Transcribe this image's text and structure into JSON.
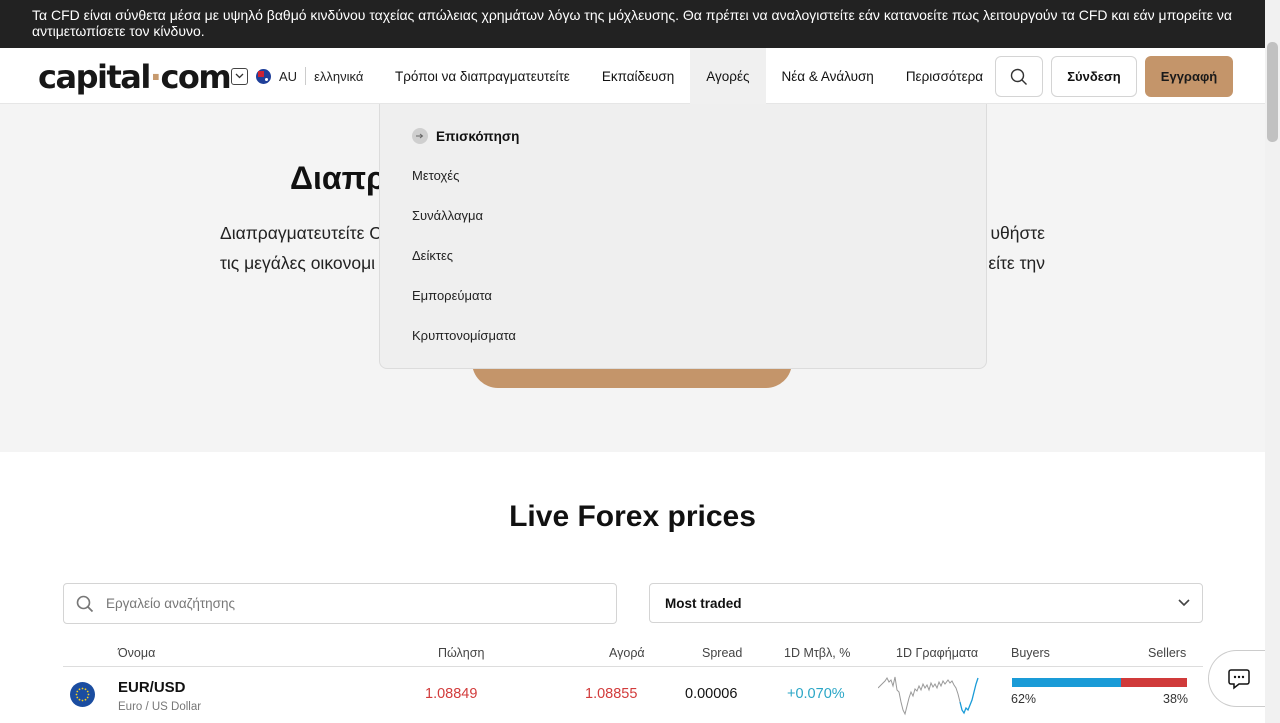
{
  "risk_warning": "Τα CFD είναι σύνθετα μέσα με υψηλό βαθμό κινδύνου ταχείας απώλειας χρημάτων λόγω της μόχλευσης. Θα πρέπει να αναλογιστείτε εάν κατανοείτε πως λειτουργούν τα CFD και εάν μπορείτε να αντιμετωπίσετε τον κίνδυνο.",
  "header": {
    "logo_main": "capital",
    "logo_dot": "·",
    "logo_tld": "com",
    "region_code": "AU",
    "language": "ελληνικά",
    "nav": [
      {
        "label": "Τρόποι να διαπραγματευτείτε"
      },
      {
        "label": "Εκπαίδευση"
      },
      {
        "label": "Αγορές"
      },
      {
        "label": "Νέα & Ανάλυση"
      },
      {
        "label": "Περισσότερα"
      }
    ],
    "login_label": "Σύνδεση",
    "signup_label": "Εγγραφή"
  },
  "hero": {
    "title": "Διαπρ",
    "text_line1": "Διαπραγματευτείτε C",
    "text_line1_end": "υθήστε",
    "text_line2": "τις μεγάλες οικονομι",
    "text_line2_end": "είτε την",
    "cta": ""
  },
  "markets_menu": {
    "overview": "Επισκόπηση",
    "items": [
      {
        "label": "Μετοχές"
      },
      {
        "label": "Συνάλλαγμα"
      },
      {
        "label": "Δείκτες"
      },
      {
        "label": "Εμπορεύματα"
      },
      {
        "label": "Κρυπτονομίσματα"
      }
    ]
  },
  "prices": {
    "title": "Live Forex prices",
    "search_placeholder": "Εργαλείο αναζήτησης",
    "sort_selected": "Most traded",
    "columns": {
      "name": "Όνομα",
      "sell": "Πώληση",
      "buy": "Αγορά",
      "spread": "Spread",
      "change": "1D Μτβλ, %",
      "chart": "1D Γραφήματα",
      "buyers": "Buyers",
      "sellers": "Sellers"
    },
    "rows": [
      {
        "symbol": "EUR/USD",
        "description": "Euro / US Dollar",
        "sell": "1.08849",
        "buy": "1.08855",
        "spread": "0.00006",
        "change": "+0.070%",
        "buyers_pct_label": "62%",
        "sellers_pct_label": "38%",
        "buyers_fraction": 0.62
      }
    ]
  },
  "colors": {
    "accent": "#c4956a",
    "risk_bar": "#222222",
    "sell": "#d23b3b",
    "change_up": "#2aa6c6",
    "buyers": "#1a9bd7",
    "sellers": "#d03a3a"
  },
  "icons": {
    "search": "search-icon",
    "chat": "chat-icon",
    "chevron": "chevron-down-icon",
    "arrow": "arrow-right-icon",
    "flag": "flag-au-icon",
    "currency": "eu-flag-icon"
  }
}
